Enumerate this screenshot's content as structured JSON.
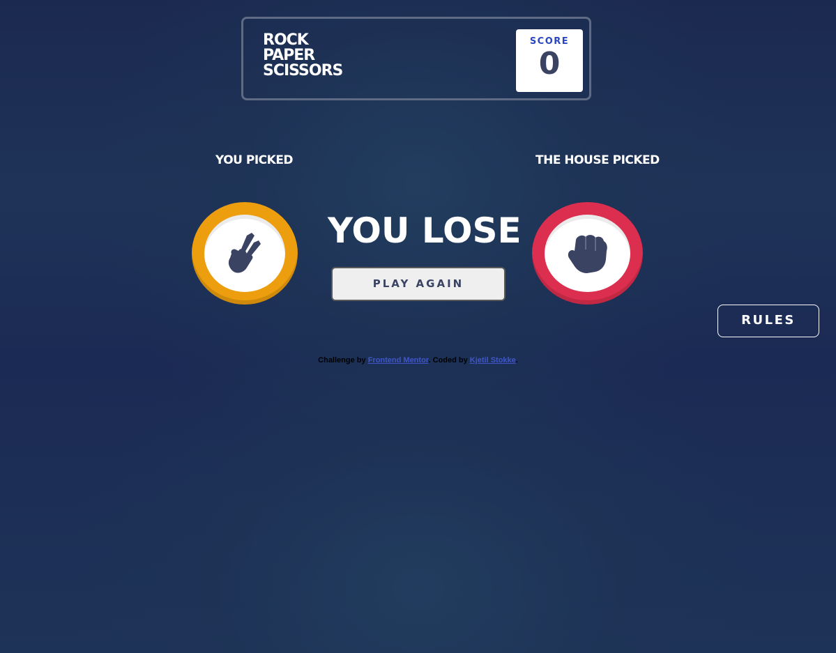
{
  "header": {
    "logo_lines": [
      "ROCK",
      "PAPER",
      "SCISSORS"
    ],
    "score_label": "SCORE",
    "score_value": "0"
  },
  "game": {
    "player_label": "YOU PICKED",
    "house_label": "THE HOUSE PICKED",
    "player_pick": "scissors",
    "house_pick": "rock",
    "result": "YOU LOSE",
    "play_again_label": "PLAY AGAIN"
  },
  "rules_button_label": "RULES",
  "attribution": {
    "prefix": "Challenge by ",
    "link1": "Frontend Mentor",
    "middle": ". Coded by ",
    "link2": "Kjetil Stokke",
    "suffix": "."
  },
  "colors": {
    "scissors_ring": "#ec9e0e",
    "rock_ring": "#dc2e4e",
    "score_label": "#2a46c0",
    "dark_text": "#3b4363"
  },
  "icons": {
    "player_icon": "scissors-hand-icon",
    "house_icon": "rock-fist-icon"
  }
}
